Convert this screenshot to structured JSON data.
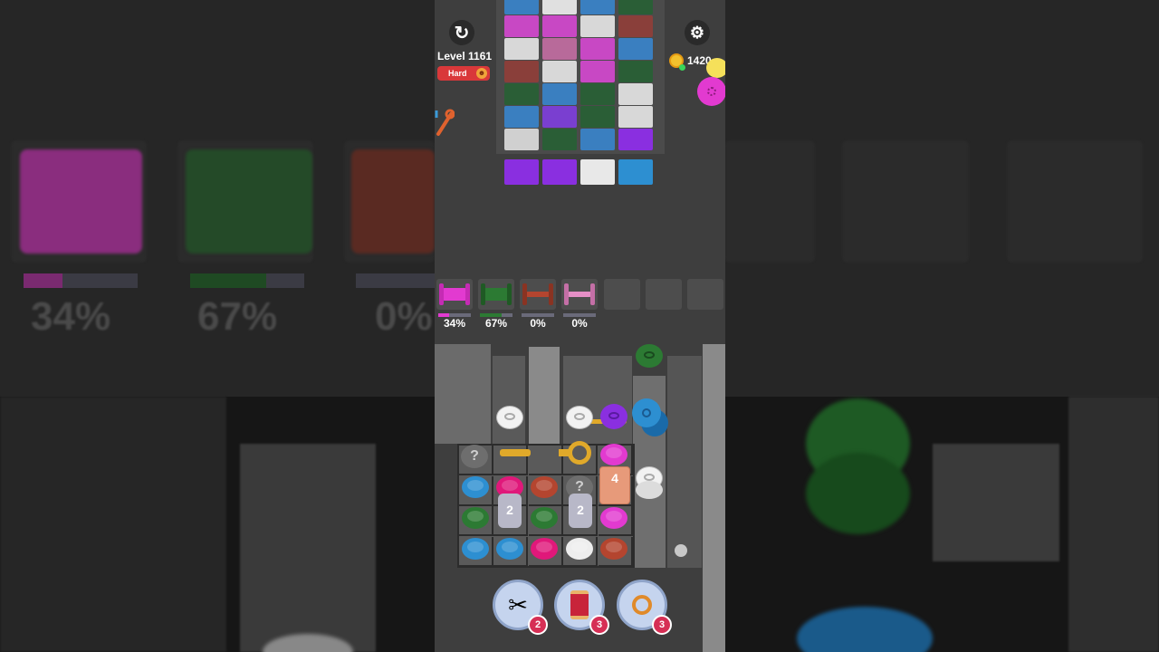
{
  "header": {
    "level_label": "Level 1161",
    "difficulty": "Hard",
    "coins": "1420"
  },
  "spools": [
    {
      "color": "#e23ad0",
      "percent": "34%",
      "progress": 0.34
    },
    {
      "color": "#2c7a33",
      "percent": "67%",
      "progress": 0.67
    },
    {
      "color": "#b4452f",
      "percent": "0%",
      "progress": 0
    },
    {
      "color": "#e58fc6",
      "percent": "0%",
      "progress": 0
    }
  ],
  "board": {
    "locked_count_a": "2",
    "locked_count_b": "2",
    "yarn_stack_count": "4",
    "hidden_marker": "?"
  },
  "boosters": [
    {
      "name": "scissors-icon",
      "count": "2"
    },
    {
      "name": "thread-spool-icon",
      "count": "3"
    },
    {
      "name": "magnet-icon",
      "count": "3"
    }
  ],
  "background": {
    "pct_a": "34%",
    "pct_b": "67%",
    "pct_c": "0%"
  },
  "colors": {
    "magenta": "#e23ad0",
    "green": "#2c7a33",
    "rust": "#b4452f",
    "pink": "#e58fc6",
    "blue": "#2d8fd1",
    "purple": "#8a2fe0",
    "white": "#e8e8e8"
  }
}
